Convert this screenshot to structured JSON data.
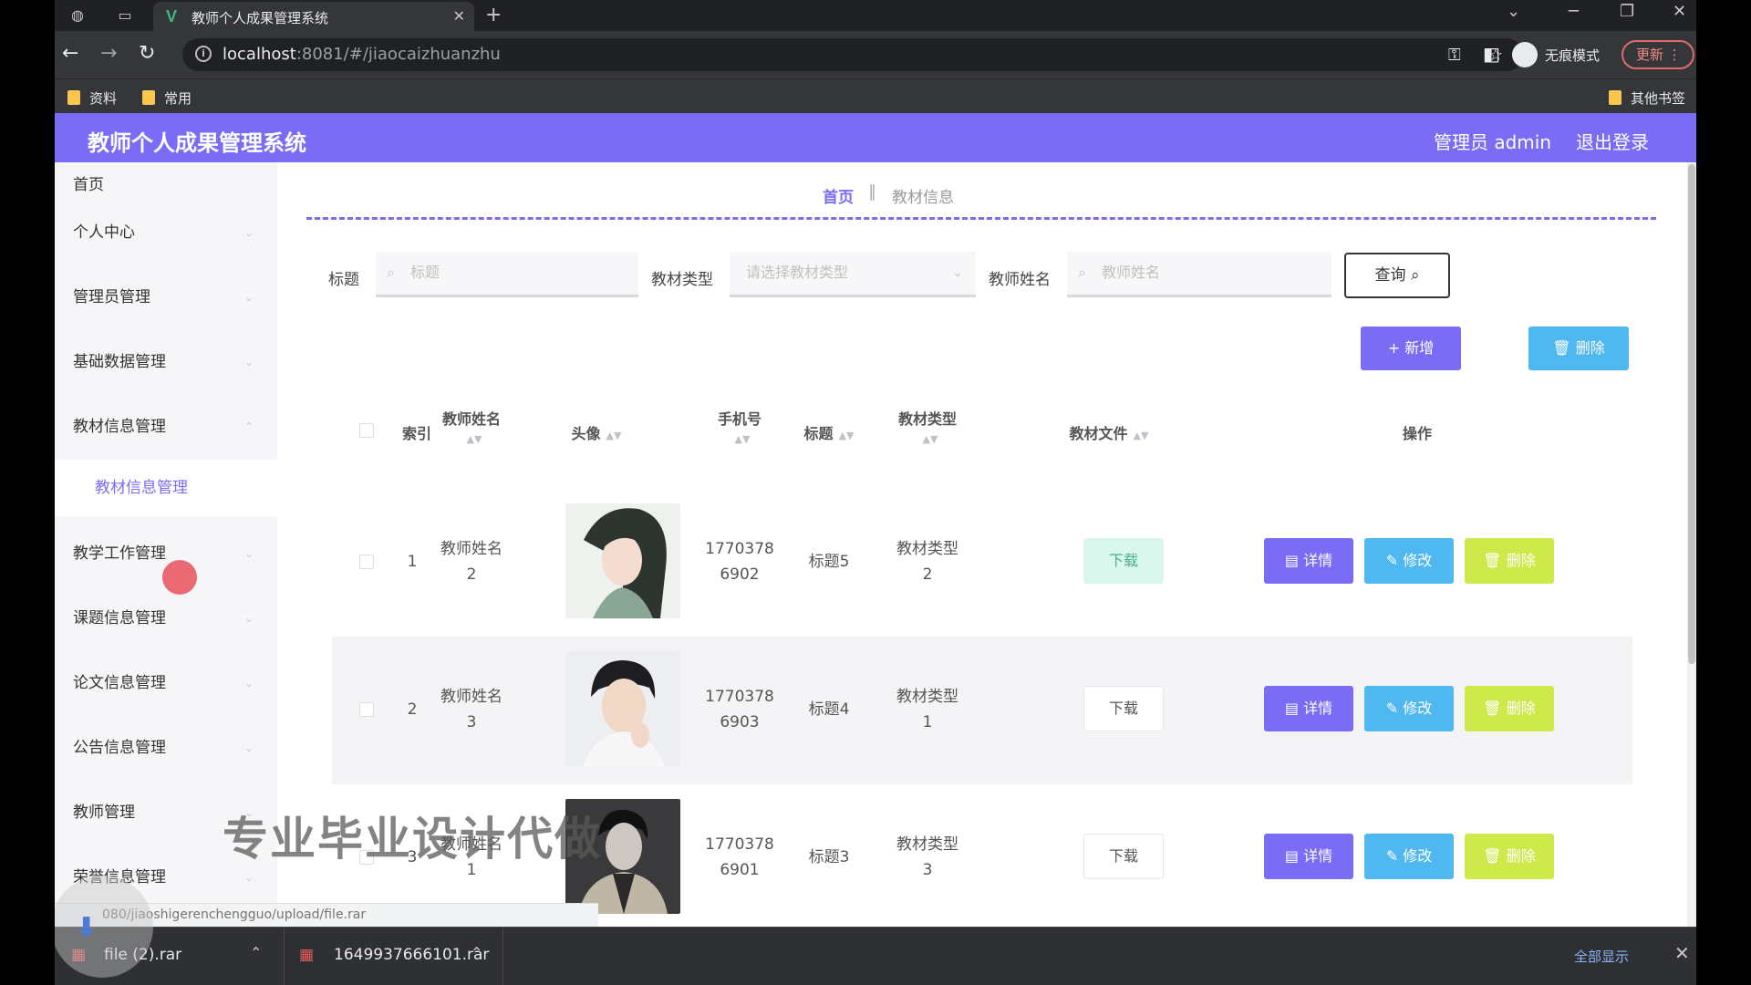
{
  "browser": {
    "tab_title": "教师个人成果管理系统",
    "tab_favicon": "V",
    "url_host": "localhost",
    "url_rest": ":8081/#/jiaocaizhuanzhu",
    "incognito_label": "无痕模式",
    "update_label": "更新",
    "bookmarks": [
      "资料",
      "常用"
    ],
    "other_bookmarks": "其他书签"
  },
  "header": {
    "title": "教师个人成果管理系统",
    "user": "管理员 admin",
    "logout": "退出登录"
  },
  "sidebar": {
    "items": [
      "首页",
      "个人中心",
      "管理员管理",
      "基础数据管理",
      "教材信息管理",
      "教学工作管理",
      "课题信息管理",
      "论文信息管理",
      "公告信息管理",
      "教师管理",
      "荣誉信息管理"
    ],
    "submenu": "教材信息管理"
  },
  "breadcrumb": {
    "home": "首页",
    "current": "教材信息"
  },
  "filters": {
    "title_label": "标题",
    "title_placeholder": "标题",
    "type_label": "教材类型",
    "type_placeholder": "请选择教材类型",
    "teacher_label": "教师姓名",
    "teacher_placeholder": "教师姓名",
    "query_button": "查询"
  },
  "actions": {
    "add": "新增",
    "delete": "删除"
  },
  "table": {
    "columns": {
      "index": "索引",
      "teacher_name": "教师姓名",
      "avatar": "头像",
      "phone": "手机号",
      "title": "标题",
      "material_type": "教材类型",
      "material_file": "教材文件",
      "operation": "操作"
    },
    "rows": [
      {
        "index": "1",
        "name1": "教师姓名",
        "name2": "2",
        "phone1": "1770378",
        "phone2": "6902",
        "title": "标题5",
        "type1": "教材类型",
        "type2": "2",
        "file": "下载"
      },
      {
        "index": "2",
        "name1": "教师姓名",
        "name2": "3",
        "phone1": "1770378",
        "phone2": "6903",
        "title": "标题4",
        "type1": "教材类型",
        "type2": "1",
        "file": "下载"
      },
      {
        "index": "3",
        "name1": "教师姓名",
        "name2": "1",
        "phone1": "1770378",
        "phone2": "6901",
        "title": "标题3",
        "type1": "教材类型",
        "type2": "3",
        "file": "下载"
      }
    ],
    "op_detail": "详情",
    "op_edit": "修改",
    "op_delete": "删除"
  },
  "watermark": "专业毕业设计代做",
  "status_url": "080/jiaoshigerenchengguo/upload/file.rar",
  "downloads": {
    "items": [
      "file (2).rar",
      "1649937666101.rar"
    ],
    "show_all": "全部显示"
  }
}
